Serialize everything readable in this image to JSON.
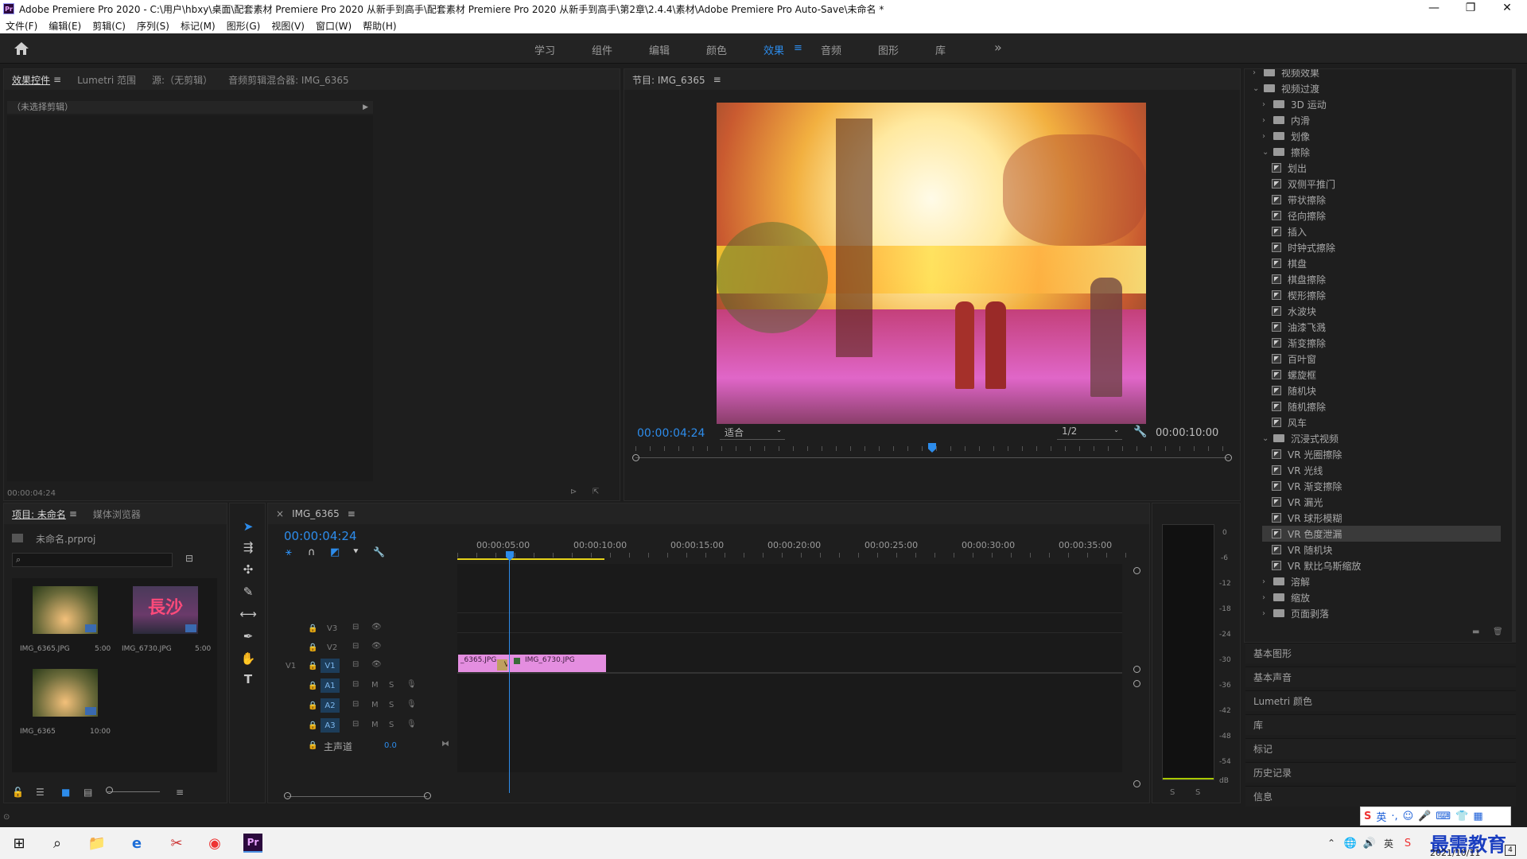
{
  "window": {
    "title": "Adobe Premiere Pro 2020 - C:\\用户\\hbxy\\桌面\\配套素材 Premiere Pro 2020 从新手到高手\\配套素材 Premiere Pro 2020 从新手到高手\\第2章\\2.4.4\\素材\\Adobe Premiere Pro Auto-Save\\未命名 *",
    "logo": "Pr",
    "minimize": "—",
    "maximize": "❐",
    "close": "✕"
  },
  "menu": [
    "文件(F)",
    "编辑(E)",
    "剪辑(C)",
    "序列(S)",
    "标记(M)",
    "图形(G)",
    "视图(V)",
    "窗口(W)",
    "帮助(H)"
  ],
  "workspaces": {
    "items": [
      "学习",
      "组件",
      "编辑",
      "颜色",
      "效果",
      "音频",
      "图形",
      "库"
    ],
    "active": "效果",
    "more": "»",
    "menu_glyph": "≡"
  },
  "effect_controls": {
    "tabs": [
      "效果控件",
      "Lumetri 范围",
      "源:（无剪辑）",
      "音频剪辑混合器: IMG_6365"
    ],
    "menu_glyph": "≡",
    "no_clip": "（未选择剪辑）",
    "timecode": "00:00:04:24"
  },
  "program": {
    "title": "节目: IMG_6365",
    "menu_glyph": "≡",
    "timecode": "00:00:04:24",
    "fit": "适合",
    "resolution": "1/2",
    "duration": "00:00:10:00",
    "playhead_fraction": 0.5
  },
  "project": {
    "tabs": [
      "项目: 未命名",
      "媒体浏览器"
    ],
    "menu_glyph": "≡",
    "file": "未命名.prproj",
    "search_placeholder": "",
    "items": [
      {
        "name": "IMG_6365.JPG",
        "duration": "5:00"
      },
      {
        "name": "IMG_6730.JPG",
        "duration": "5:00"
      },
      {
        "name": "IMG_6365",
        "duration": "10:00"
      }
    ],
    "thumb_text": "長沙"
  },
  "timeline": {
    "tab_close": "×",
    "sequence": "IMG_6365",
    "menu_glyph": "≡",
    "timecode": "00:00:04:24",
    "ruler": [
      "00:00:05:00",
      "00:00:10:00",
      "00:00:15:00",
      "00:00:20:00",
      "00:00:25:00",
      "00:00:30:00",
      "00:00:35:00"
    ],
    "video_tracks": [
      "V3",
      "V2",
      "V1"
    ],
    "v1_source": "V1",
    "audio_tracks": [
      "A1",
      "A2",
      "A3"
    ],
    "mute": "M",
    "solo": "S",
    "master": "主声道",
    "master_value": "0.0",
    "clips": [
      {
        "name": "_6365.JPG"
      },
      {
        "name": "IMG_6730.JPG"
      }
    ],
    "transition_label": "V"
  },
  "meter": {
    "labels": [
      "0",
      "-6",
      "-12",
      "-18",
      "-24",
      "-30",
      "-36",
      "-42",
      "-48",
      "-54",
      "dB"
    ],
    "solo": [
      "S",
      "S"
    ]
  },
  "effects_tree": {
    "top_partial": "视频效果",
    "transitions": "视频过渡",
    "groups_before": [
      "3D 运动",
      "内滑",
      "划像"
    ],
    "wipe": "擦除",
    "wipe_items": [
      "划出",
      "双侧平推门",
      "带状擦除",
      "径向擦除",
      "插入",
      "时钟式擦除",
      "棋盘",
      "棋盘擦除",
      "楔形擦除",
      "水波块",
      "油漆飞溅",
      "渐变擦除",
      "百叶窗",
      "螺旋框",
      "随机块",
      "随机擦除",
      "风车"
    ],
    "immersive": "沉浸式视频",
    "immersive_items": [
      "VR 光圈擦除",
      "VR 光线",
      "VR 渐变擦除",
      "VR 漏光",
      "VR 球形模糊",
      "VR 色度泄漏",
      "VR 随机块",
      "VR 默比乌斯缩放"
    ],
    "selected": "VR 色度泄漏",
    "groups_after": [
      "溶解",
      "缩放",
      "页面剥落"
    ]
  },
  "side_panels": [
    "基本图形",
    "基本声音",
    "Lumetri 颜色",
    "库",
    "标记",
    "历史记录",
    "信息"
  ],
  "taskbar": {
    "ime": "英",
    "date": "2021/10/11",
    "watermark": "最需教育",
    "notification": "4"
  },
  "colors": {
    "accent": "#2d8ceb",
    "clip_pink": "#e48ee0",
    "playhead": "#2d8ceb",
    "work_area": "#e5d21a"
  }
}
